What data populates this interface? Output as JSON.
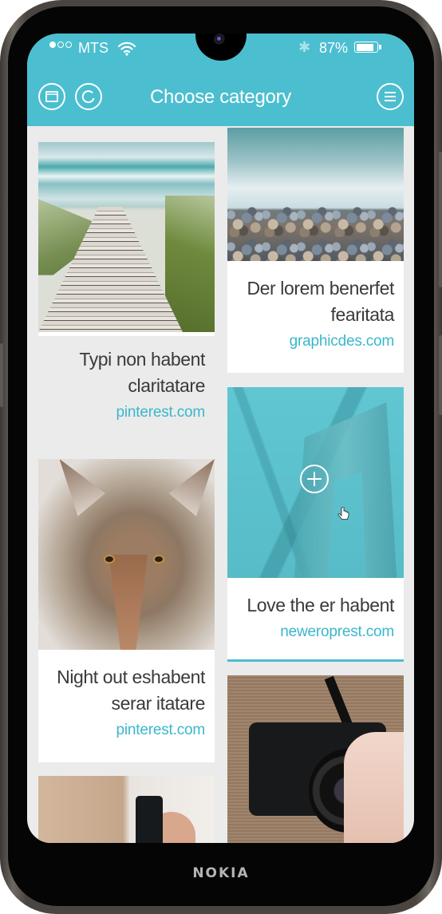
{
  "device": {
    "brand": "NOKIA"
  },
  "status_bar": {
    "carrier": "MTS",
    "signal_strength": "1 of 3",
    "wifi_icon": "wifi-icon",
    "bluetooth_icon": "bluetooth-icon",
    "battery_percent": "87%",
    "battery_level": 0.87
  },
  "header": {
    "title": "Choose category",
    "left_buttons": [
      {
        "icon": "window-icon",
        "label": "Window"
      },
      {
        "icon": "refresh-icon",
        "label": "Refresh"
      }
    ],
    "right_button": {
      "icon": "menu-icon",
      "label": "Menu"
    },
    "color": "#4bbfd0"
  },
  "cards": {
    "left": [
      {
        "image": "beach boardwalk",
        "caption_line1": "Typi non habent",
        "caption_line2": "claritatare",
        "source": "pinterest.com"
      },
      {
        "image": "coyote face",
        "caption_line1": "Night out eshabent",
        "caption_line2": "serar itatare",
        "source": "pinterest.com"
      },
      {
        "image": "hand holding phone in room"
      }
    ],
    "right": [
      {
        "image": "pebbles and surf",
        "caption_line1": "Der lorem benerfet",
        "caption_line2": "fearitata",
        "source": "graphicdes.com"
      },
      {
        "image": "bridge tower (teal overlay)",
        "caption_line1": "Love the er habent",
        "source": "neweroprest.com",
        "active": true,
        "overlay_icon": "plus-icon"
      },
      {
        "image": "hands holding Yashica camera"
      }
    ]
  },
  "colors": {
    "accent": "#4bbfd0",
    "link": "#3bb7cc",
    "text": "#3a3a3a",
    "background": "#ebebeb"
  }
}
